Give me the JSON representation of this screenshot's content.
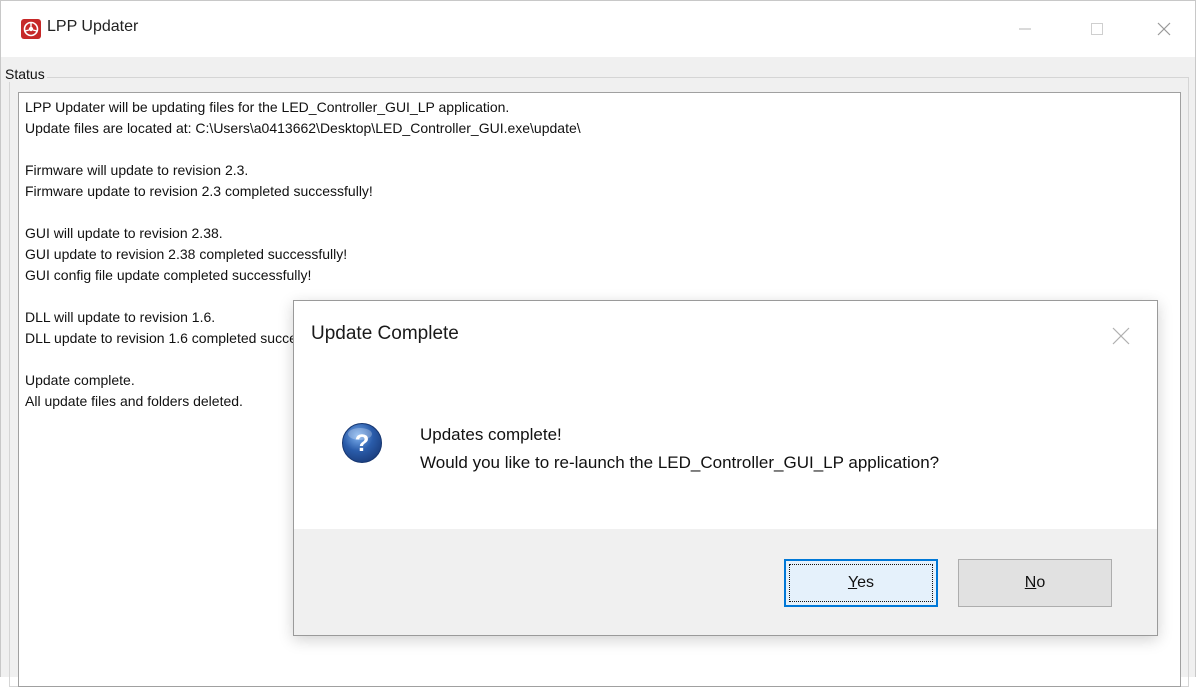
{
  "window": {
    "title": "LPP Updater",
    "icons": {
      "app": "lpp-app-icon",
      "minimize": "minimize-icon",
      "maximize": "maximize-icon",
      "close": "close-icon"
    }
  },
  "status_group": {
    "label": "Status",
    "lines": [
      "LPP Updater will be updating files for the LED_Controller_GUI_LP application.",
      "Update files are located at: C:\\Users\\a0413662\\Desktop\\LED_Controller_GUI.exe\\update\\",
      "",
      "Firmware will update to revision 2.3.",
      "Firmware update to revision 2.3 completed successfully!",
      "",
      "GUI will update to revision 2.38.",
      "GUI update to revision 2.38 completed successfully!",
      "GUI config file update completed successfully!",
      "",
      "DLL will update to revision 1.6.",
      "DLL update to revision 1.6 completed successfully!",
      "",
      "Update complete.",
      "All update files and folders deleted."
    ]
  },
  "dialog": {
    "title": "Update Complete",
    "icon": "question-icon",
    "message_line1": "Updates complete!",
    "message_line2": "Would you like to re-launch the LED_Controller_GUI_LP application?",
    "yes_mnemonic": "Y",
    "yes_rest": "es",
    "no_mnemonic": "N",
    "no_rest": "o"
  },
  "colors": {
    "accent": "#0078d7",
    "question_icon": "#2a5caa"
  }
}
